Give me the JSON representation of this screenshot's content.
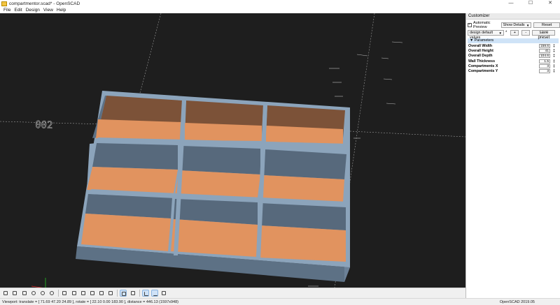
{
  "window": {
    "title": "compartmentor.scad* - OpenSCAD",
    "controls": [
      "—",
      "☐",
      "✕"
    ]
  },
  "menu": [
    "File",
    "Edit",
    "Design",
    "View",
    "Help"
  ],
  "viewport": {
    "axis_label": "002",
    "colors": {
      "floor": "#e1935f",
      "wall": "#6a8096",
      "rim": "#8ca4bb",
      "backwall": "#7a5238"
    }
  },
  "toolbar": {
    "icons": [
      "preview-icon",
      "render-icon",
      "view-all-icon",
      "zoom-in-icon",
      "zoom-out-icon",
      "reset-view-icon",
      "view-right-icon",
      "view-top-icon",
      "view-bottom-icon",
      "view-left-icon",
      "view-front-icon",
      "view-back-icon",
      "perspective-icon",
      "orthogonal-icon",
      "show-axes-icon",
      "show-scale-icon",
      "show-edges-icon"
    ]
  },
  "status": {
    "viewport_info": "Viewport: translate = [ 71.69 47.20 24.89 ], rotate = [ 22.10 0.00 183.90 ], distance = 446.13 (1597x948)",
    "version": "OpenSCAD 2019.05"
  },
  "customizer": {
    "title": "Customizer",
    "auto_preview_label": "Automatic Preview",
    "auto_preview_checked": true,
    "details_select": "Show Details",
    "reset_label": "Reset",
    "preset_select": "design default values",
    "preset_modified": "*",
    "add_label": "+",
    "remove_label": "-",
    "save_preset_label": "save preset",
    "section_label": "Parameters",
    "parameters": [
      {
        "label": "Overall Width",
        "value": "159.6"
      },
      {
        "label": "Overall Height",
        "value": "41"
      },
      {
        "label": "Overall Depth",
        "value": "104.6"
      },
      {
        "label": "Wall Thickness",
        "value": "1.5"
      },
      {
        "label": "Compartments X",
        "value": "3"
      },
      {
        "label": "Compartments Y",
        "value": "3"
      }
    ]
  }
}
